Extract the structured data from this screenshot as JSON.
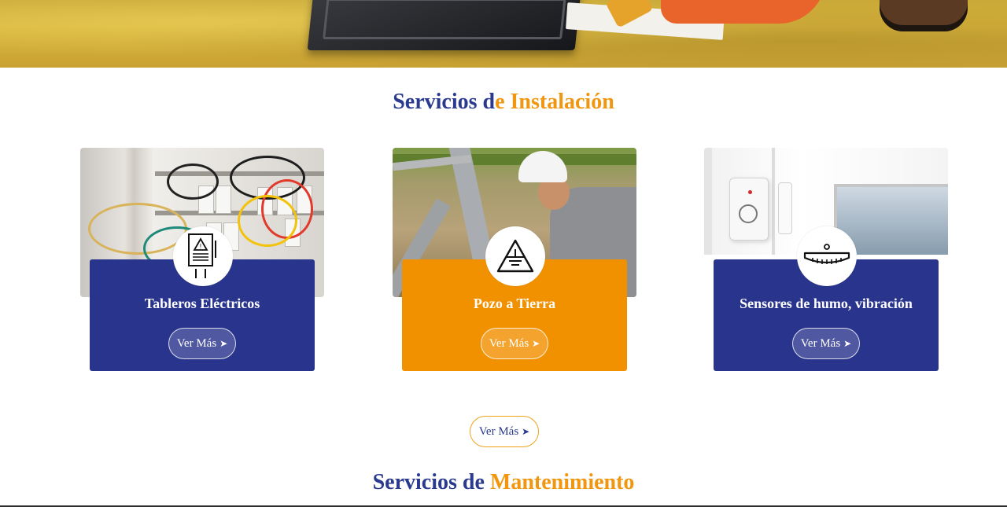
{
  "installation": {
    "title_part1": "Servicios d",
    "title_part2": "e Instalación",
    "cards": [
      {
        "title": "Tableros Eléctricos",
        "button": "Ver Más",
        "color": "#29348c",
        "icon": "electrical-panel-icon"
      },
      {
        "title": "Pozo a Tierra",
        "button": "Ver Más",
        "color": "#f29100",
        "icon": "ground-symbol-icon"
      },
      {
        "title": "Sensores de humo, vibración",
        "button": "Ver Más",
        "color": "#29348c",
        "icon": "smoke-detector-icon"
      }
    ],
    "more_button": "Ver Más"
  },
  "maintenance": {
    "title_part1": "Servicios de ",
    "title_part2": "Mantenimiento"
  },
  "colors": {
    "brand_blue": "#2a3a8f",
    "brand_orange": "#f0960f"
  },
  "icons": {
    "chevron": "chevron-right-icon"
  }
}
